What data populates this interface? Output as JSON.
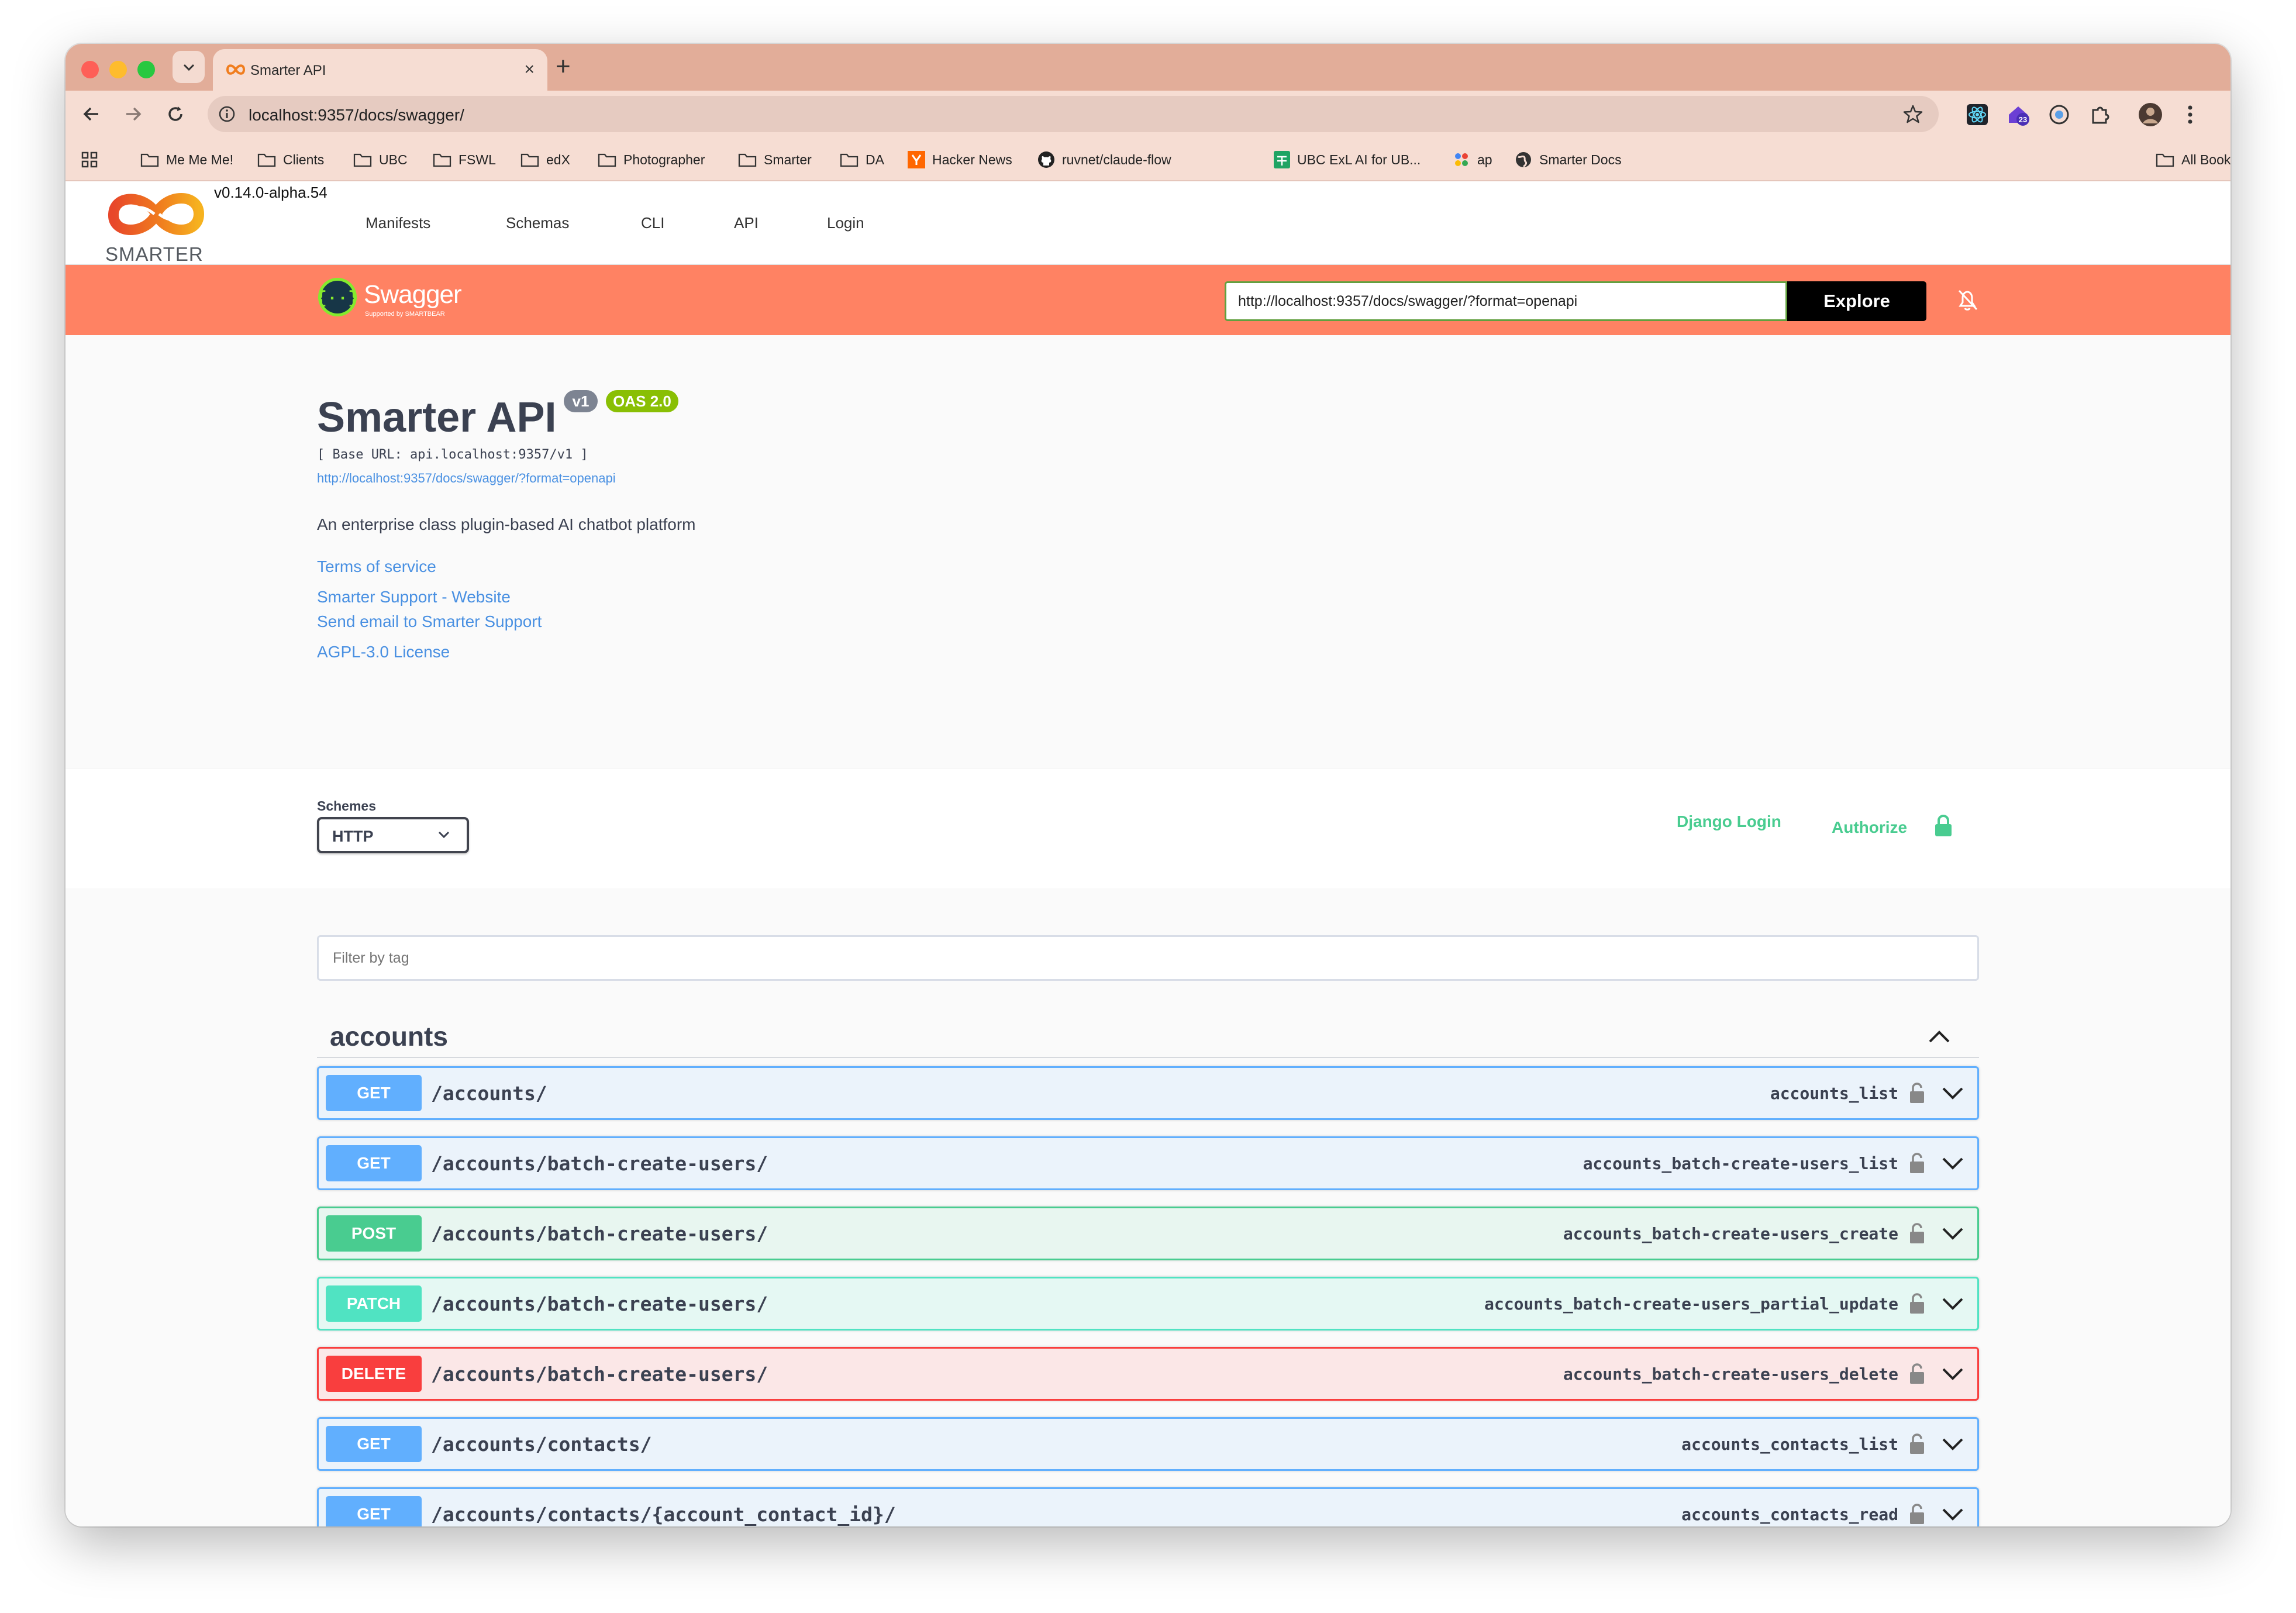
{
  "browser": {
    "tab_title": "Smarter API",
    "url": "localhost:9357/docs/swagger/",
    "bookmarks": [
      "Me Me Me!",
      "Clients",
      "UBC",
      "FSWL",
      "edX",
      "Photographer",
      "Smarter",
      "DA",
      "Hacker News",
      "ruvnet/claude-flow",
      "UBC ExL AI for UB...",
      "ap",
      "Smarter Docs"
    ],
    "all_bookmarks": "All Bookmarks",
    "extension_badge": "23"
  },
  "site": {
    "logo_text": "SMARTER",
    "version": "v0.14.0-alpha.54",
    "nav": [
      "Manifests",
      "Schemas",
      "CLI",
      "API",
      "Login"
    ]
  },
  "swagger": {
    "brand": "Swagger",
    "brand_sub": "Supported by SMARTBEAR",
    "explore_url": "http://localhost:9357/docs/swagger/?format=openapi",
    "explore_label": "Explore"
  },
  "info": {
    "title": "Smarter API",
    "version_badge": "v1",
    "oas_badge": "OAS 2.0",
    "base_url": "[ Base URL: api.localhost:9357/v1 ]",
    "spec_link": "http://localhost:9357/docs/swagger/?format=openapi",
    "description": "An enterprise class plugin-based AI chatbot platform",
    "links": {
      "terms": "Terms of service",
      "support_website": "Smarter Support - Website",
      "support_email": "Send email to Smarter Support",
      "license": "AGPL-3.0 License"
    }
  },
  "schemes": {
    "label": "Schemes",
    "selected": "HTTP",
    "django_login": "Django Login",
    "authorize": "Authorize"
  },
  "operations": {
    "filter_placeholder": "Filter by tag",
    "tag": "accounts",
    "items": [
      {
        "method": "GET",
        "path": "/accounts/",
        "operation_id": "accounts_list"
      },
      {
        "method": "GET",
        "path": "/accounts/batch-create-users/",
        "operation_id": "accounts_batch-create-users_list"
      },
      {
        "method": "POST",
        "path": "/accounts/batch-create-users/",
        "operation_id": "accounts_batch-create-users_create"
      },
      {
        "method": "PATCH",
        "path": "/accounts/batch-create-users/",
        "operation_id": "accounts_batch-create-users_partial_update"
      },
      {
        "method": "DELETE",
        "path": "/accounts/batch-create-users/",
        "operation_id": "accounts_batch-create-users_delete"
      },
      {
        "method": "GET",
        "path": "/accounts/contacts/",
        "operation_id": "accounts_contacts_list"
      },
      {
        "method": "GET",
        "path": "/accounts/contacts/{account_contact_id}/",
        "operation_id": "accounts_contacts_read"
      }
    ]
  },
  "colors": {
    "get": "#61affe",
    "post": "#49cc90",
    "patch": "#50e3c2",
    "delete": "#f93e3e",
    "swagger_topbar": "#ff8263",
    "tab_strip": "#e2ad99"
  },
  "icons": [
    "back-arrow-icon",
    "forward-arrow-icon",
    "reload-icon",
    "site-info-icon",
    "bookmark-star-icon",
    "apps-grid-icon",
    "folder-icon",
    "github-icon",
    "globe-icon",
    "lock-icon",
    "chevron-down-icon",
    "chevron-up-icon",
    "bell-off-icon",
    "swagger-logo-icon",
    "smarter-logo-icon"
  ]
}
